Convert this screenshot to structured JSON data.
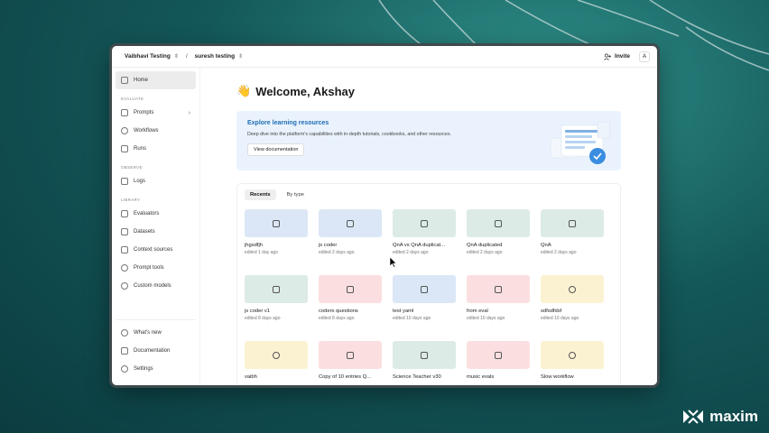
{
  "topbar": {
    "workspace": "Vaibhavi Testing",
    "separator": "/",
    "project": "suresh testing",
    "invite_label": "Invite",
    "avatar_letter": "A"
  },
  "sidebar": {
    "home": "Home",
    "evaluate_section": "EVALUATE",
    "prompts": "Prompts",
    "workflows": "Workflows",
    "runs": "Runs",
    "observe_section": "OBSERVE",
    "logs": "Logs",
    "library_section": "LIBRARY",
    "evaluators": "Evaluators",
    "datasets": "Datasets",
    "context_sources": "Context sources",
    "prompt_tools": "Prompt tools",
    "custom_models": "Custom models",
    "whats_new": "What's new",
    "documentation": "Documentation",
    "settings": "Settings"
  },
  "main": {
    "welcome_emoji": "👋",
    "welcome": "Welcome, Akshay",
    "banner": {
      "title": "Explore learning resources",
      "description": "Deep dive into the platform's capabilities with in-depth tutorials, cookbooks, and other resources.",
      "button": "View documentation"
    },
    "tabs": [
      "Recents",
      "By type"
    ],
    "cards": [
      {
        "title": "jhgsdfjh",
        "sub": "edited 1 day ago",
        "color": "blue",
        "icon": "prompt-icon"
      },
      {
        "title": "js coder",
        "sub": "edited 2 days ago",
        "color": "blue",
        "icon": "prompt-icon"
      },
      {
        "title": "QnA vs QnA duplicat...",
        "sub": "edited 2 days ago",
        "color": "green",
        "icon": "comparison-icon"
      },
      {
        "title": "QnA duplicated",
        "sub": "edited 2 days ago",
        "color": "green",
        "icon": "comparison-icon"
      },
      {
        "title": "QnA",
        "sub": "edited 2 days ago",
        "color": "green",
        "icon": "comparison-icon"
      },
      {
        "title": "js coder v1",
        "sub": "edited 8 days ago",
        "color": "green",
        "icon": "comparison-icon"
      },
      {
        "title": "coders questions",
        "sub": "edited 8 days ago",
        "color": "pink",
        "icon": "dataset-icon"
      },
      {
        "title": "test yaml",
        "sub": "edited 10 days ago",
        "color": "blue",
        "icon": "prompt-icon"
      },
      {
        "title": "from eval",
        "sub": "edited 10 days ago",
        "color": "pink",
        "icon": "dataset-icon"
      },
      {
        "title": "sdfsdfdsf",
        "sub": "edited 10 days ago",
        "color": "yellow",
        "icon": "workflow-icon"
      },
      {
        "title": "vaibh",
        "sub": "",
        "color": "yellow",
        "icon": "workflow-icon"
      },
      {
        "title": "Copy of 10 entries Q...",
        "sub": "",
        "color": "pink",
        "icon": "dataset-icon"
      },
      {
        "title": "Science Teacher v30",
        "sub": "",
        "color": "green",
        "icon": "comparison-icon"
      },
      {
        "title": "music evals",
        "sub": "",
        "color": "pink",
        "icon": "dataset-icon"
      },
      {
        "title": "Slow workflow",
        "sub": "",
        "color": "yellow",
        "icon": "workflow-icon"
      }
    ]
  },
  "brand": {
    "name": "maxim"
  },
  "colors": {
    "accent_blue": "#1e6db5",
    "card_blue": "#dbe7f6",
    "card_green": "#dcebe5",
    "card_pink": "#fbdfe0",
    "card_yellow": "#fbf2d2",
    "background_teal": "#14585a"
  }
}
